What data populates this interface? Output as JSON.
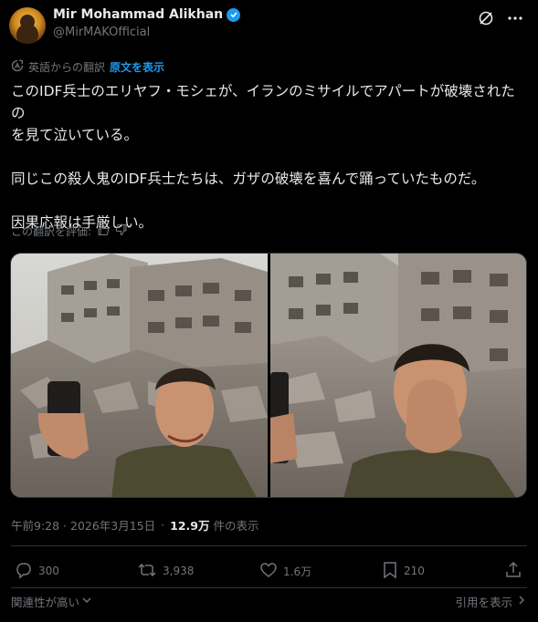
{
  "author": {
    "display_name": "Mir Mohammad Alikhan",
    "handle": "@MirMAKOfficial"
  },
  "translation": {
    "label": "英語からの翻訳",
    "show_original": "原文を表示"
  },
  "tweet": {
    "para1_line1": "このIDF兵士のエリヤフ・モシェが、イランのミサイルでアパートが破壊されたの",
    "para1_line2": "を見て泣いている。",
    "para2": "同じこの殺人鬼のIDF兵士たちは、ガザの破壊を喜んで踊っていたものだ。",
    "para3": "因果応報は手厳しい。"
  },
  "rate_translation": "この翻訳を評価:",
  "meta": {
    "timestamp": "午前9:28 · 2026年3月15日",
    "views_count": "12.9万",
    "views_label": "件の表示"
  },
  "actions": {
    "replies": "300",
    "reposts": "3,938",
    "likes": "1.6万",
    "bookmarks": "210"
  },
  "footer": {
    "relevance": "関連性が高い",
    "view_quotes": "引用を表示"
  },
  "colors": {
    "accent": "#1d9bf0",
    "background": "#000000",
    "text": "#e7e9ea",
    "muted": "#71767b"
  }
}
